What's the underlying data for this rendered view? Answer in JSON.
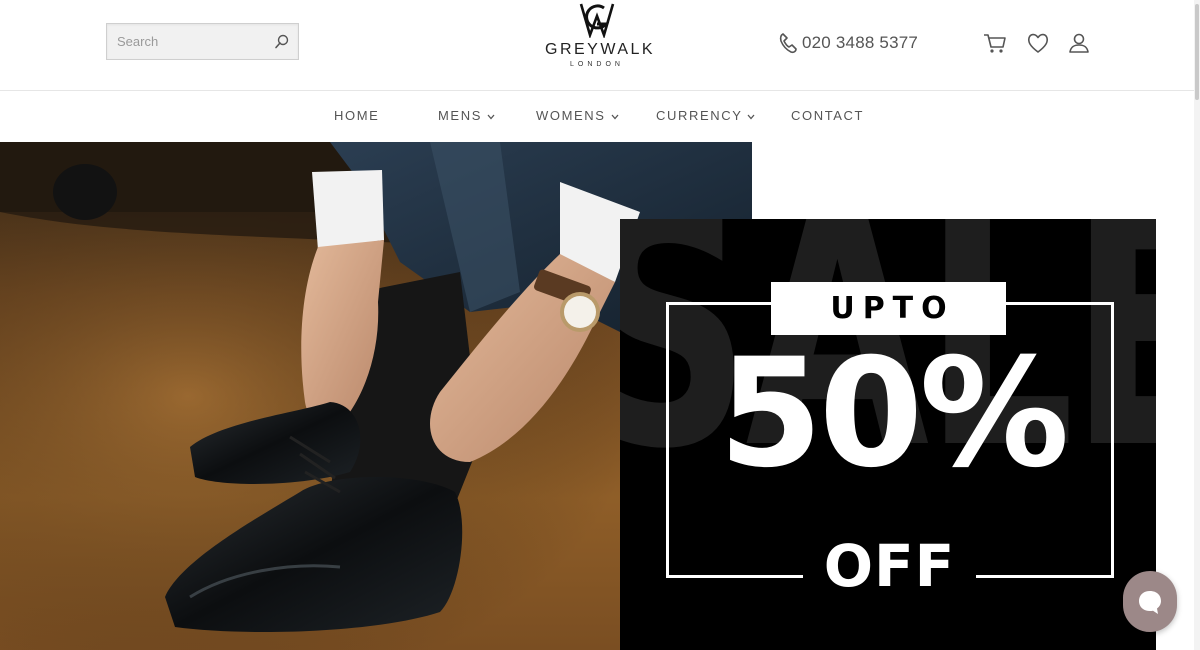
{
  "search": {
    "placeholder": "Search",
    "value": ""
  },
  "brand": {
    "name": "GREYWALK",
    "sub": "LONDON",
    "monogram": "GW"
  },
  "contact": {
    "phone": "020 3488 5377"
  },
  "header_icons": [
    "cart-icon",
    "heart-icon",
    "user-icon"
  ],
  "nav": {
    "items": [
      {
        "label": "HOME",
        "dropdown": false
      },
      {
        "label": "MENS",
        "dropdown": true
      },
      {
        "label": "WOMENS",
        "dropdown": true
      },
      {
        "label": "CURRENCY",
        "dropdown": true
      },
      {
        "label": "CONTACT",
        "dropdown": false
      }
    ]
  },
  "promo": {
    "upto": "UPTO",
    "percent": "50%",
    "off": "OFF",
    "watermark": "SALE"
  },
  "colors": {
    "text": "#555555",
    "panel": "#000000",
    "chat": "#9c8888",
    "floor": "#8a5a25",
    "suit": "#1f2f3f"
  }
}
